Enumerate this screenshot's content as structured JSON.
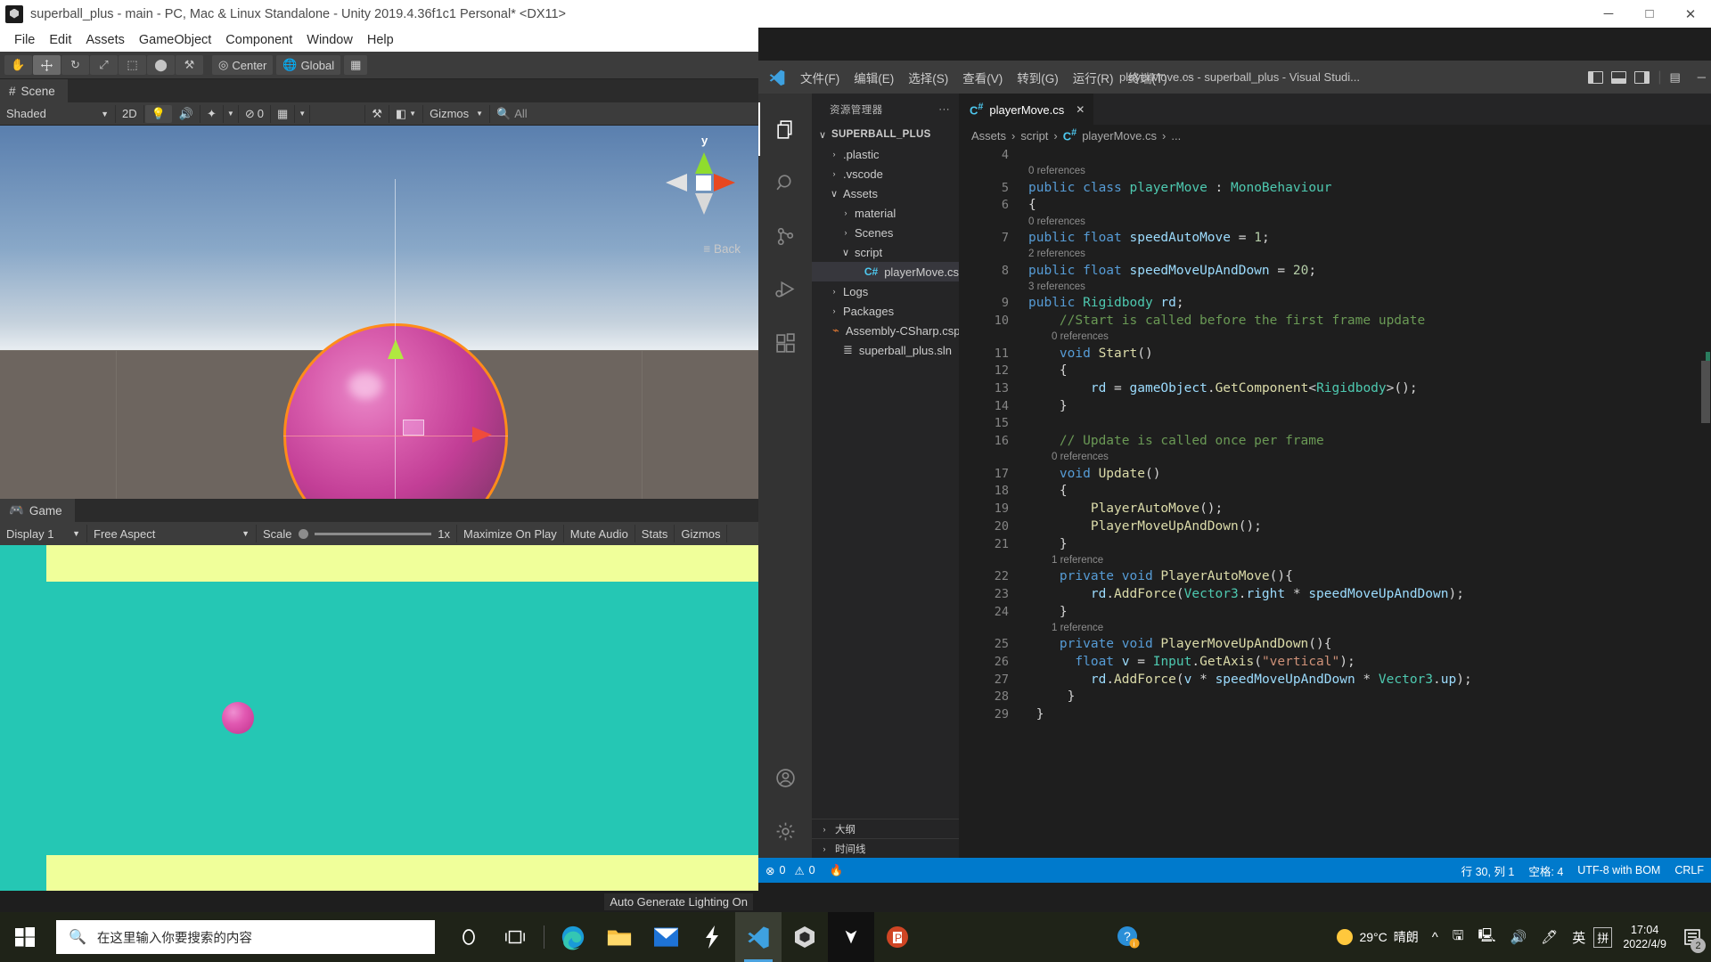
{
  "unity": {
    "title": "superball_plus - main - PC, Mac & Linux Standalone - Unity 2019.4.36f1c1 Personal* <DX11>",
    "window_buttons": {
      "minimize": "─",
      "maximize": "□",
      "close": "✕"
    },
    "menu": [
      "File",
      "Edit",
      "Assets",
      "GameObject",
      "Component",
      "Window",
      "Help"
    ],
    "toolbar": {
      "tools": [
        "hand-tool",
        "move-tool",
        "rotate-tool",
        "scale-tool",
        "rect-tool",
        "transform-tool",
        "custom-tool"
      ],
      "pivot_label": "Center",
      "space_label": "Global",
      "grid_label": "grid-snap"
    },
    "scene_tab": "Scene",
    "scene_controls": {
      "shading": "Shaded",
      "mode_2d": "2D",
      "lighting": "lighting-toggle",
      "audio": "audio-toggle",
      "fx": "effects-toggle",
      "hidden_count": "0",
      "grid": "grid-toggle",
      "tools": "scene-tools",
      "camera": "camera-toggle",
      "gizmos": "Gizmos",
      "search_placeholder": "All"
    },
    "gizmo": {
      "axis_y": "y",
      "view_label": "Back"
    },
    "game_tab": "Game",
    "game_controls": {
      "display": "Display 1",
      "aspect": "Free Aspect",
      "scale_label": "Scale",
      "scale_value": "1x",
      "maximize": "Maximize On Play",
      "mute": "Mute Audio",
      "stats": "Stats",
      "gizmos": "Gizmos"
    },
    "lighting_note": "Auto Generate Lighting On"
  },
  "vscode": {
    "menu": [
      "文件(F)",
      "编辑(E)",
      "选择(S)",
      "查看(V)",
      "转到(G)",
      "运行(R)",
      "终端(T)",
      "···"
    ],
    "window_title": "playerMove.cs - superball_plus - Visual Studi...",
    "minimize": "─",
    "activity_icons": [
      "explorer-icon",
      "search-icon",
      "source-control-icon",
      "run-debug-icon",
      "extensions-icon",
      "account-icon",
      "settings-gear-icon"
    ],
    "sidebar": {
      "header": "资源管理器",
      "more": "···",
      "tree": [
        {
          "label": "SUPERBALL_PLUS",
          "indent": 0,
          "chev": "∨",
          "root": true
        },
        {
          "label": ".plastic",
          "indent": 1,
          "chev": "›"
        },
        {
          "label": ".vscode",
          "indent": 1,
          "chev": "›"
        },
        {
          "label": "Assets",
          "indent": 1,
          "chev": "∨"
        },
        {
          "label": "material",
          "indent": 2,
          "chev": "›"
        },
        {
          "label": "Scenes",
          "indent": 2,
          "chev": "›"
        },
        {
          "label": "script",
          "indent": 2,
          "chev": "∨"
        },
        {
          "label": "playerMove.cs",
          "indent": 3,
          "chev": "",
          "icon": "csharp-file-icon",
          "selected": true
        },
        {
          "label": "Logs",
          "indent": 1,
          "chev": "›"
        },
        {
          "label": "Packages",
          "indent": 1,
          "chev": "›"
        },
        {
          "label": "Assembly-CSharp.csp...",
          "indent": 1,
          "chev": "",
          "icon": "config-file-icon"
        },
        {
          "label": "superball_plus.sln",
          "indent": 1,
          "chev": "",
          "icon": "solution-file-icon"
        }
      ],
      "panels": [
        {
          "label": "大纲",
          "chev": "›"
        },
        {
          "label": "时间线",
          "chev": "›"
        }
      ]
    },
    "tab": {
      "label": "playerMove.cs",
      "close": "✕"
    },
    "breadcrumb": [
      "Assets",
      "script",
      "playerMove.cs",
      "..."
    ],
    "code_lines": [
      {
        "no": "4",
        "segs": []
      },
      {
        "ref": "0 references",
        "indent": 0
      },
      {
        "no": "5",
        "segs": [
          [
            "kw",
            "public "
          ],
          [
            "kw",
            "class "
          ],
          [
            "ty",
            "playerMove"
          ],
          [
            "pn",
            " : "
          ],
          [
            "ty",
            "MonoBehaviour"
          ]
        ]
      },
      {
        "no": "6",
        "segs": [
          [
            "pn",
            "{"
          ]
        ]
      },
      {
        "ref": "0 references",
        "indent": 0
      },
      {
        "no": "7",
        "segs": [
          [
            "kw",
            "public "
          ],
          [
            "kw",
            "float "
          ],
          [
            "va",
            "speedAutoMove"
          ],
          [
            "pn",
            " = "
          ],
          [
            "nu",
            "1"
          ],
          [
            "pn",
            ";"
          ]
        ]
      },
      {
        "ref": "2 references",
        "indent": 0
      },
      {
        "no": "8",
        "segs": [
          [
            "kw",
            "public "
          ],
          [
            "kw",
            "float "
          ],
          [
            "va",
            "speedMoveUpAndDown"
          ],
          [
            "pn",
            " = "
          ],
          [
            "nu",
            "20"
          ],
          [
            "pn",
            ";"
          ]
        ]
      },
      {
        "ref": "3 references",
        "indent": 0
      },
      {
        "no": "9",
        "segs": [
          [
            "kw",
            "public "
          ],
          [
            "ty",
            "Rigidbody"
          ],
          [
            "pn",
            " "
          ],
          [
            "va",
            "rd"
          ],
          [
            "pn",
            ";"
          ]
        ]
      },
      {
        "no": "10",
        "segs": [
          [
            "cm",
            "    //Start is called before the first frame update"
          ]
        ]
      },
      {
        "ref": "0 references",
        "indent": 1
      },
      {
        "no": "11",
        "segs": [
          [
            "pn",
            "    "
          ],
          [
            "kw",
            "void "
          ],
          [
            "fn",
            "Start"
          ],
          [
            "pn",
            "()"
          ]
        ]
      },
      {
        "no": "12",
        "segs": [
          [
            "pn",
            "    {"
          ]
        ]
      },
      {
        "no": "13",
        "segs": [
          [
            "pn",
            "        "
          ],
          [
            "va",
            "rd"
          ],
          [
            "pn",
            " = "
          ],
          [
            "va",
            "gameObject"
          ],
          [
            "pn",
            "."
          ],
          [
            "fn",
            "GetComponent"
          ],
          [
            "pn",
            "<"
          ],
          [
            "ty",
            "Rigidbody"
          ],
          [
            "pn",
            ">();"
          ]
        ]
      },
      {
        "no": "14",
        "segs": [
          [
            "pn",
            "    }"
          ]
        ]
      },
      {
        "no": "15",
        "segs": []
      },
      {
        "no": "16",
        "segs": [
          [
            "cm",
            "    // Update is called once per frame"
          ]
        ]
      },
      {
        "ref": "0 references",
        "indent": 1
      },
      {
        "no": "17",
        "segs": [
          [
            "pn",
            "    "
          ],
          [
            "kw",
            "void "
          ],
          [
            "fn",
            "Update"
          ],
          [
            "pn",
            "()"
          ]
        ]
      },
      {
        "no": "18",
        "segs": [
          [
            "pn",
            "    {"
          ]
        ]
      },
      {
        "no": "19",
        "segs": [
          [
            "pn",
            "        "
          ],
          [
            "fn",
            "PlayerAutoMove"
          ],
          [
            "pn",
            "();"
          ]
        ]
      },
      {
        "no": "20",
        "segs": [
          [
            "pn",
            "        "
          ],
          [
            "fn",
            "PlayerMoveUpAndDown"
          ],
          [
            "pn",
            "();"
          ]
        ]
      },
      {
        "no": "21",
        "segs": [
          [
            "pn",
            "    }"
          ]
        ]
      },
      {
        "ref": "1 reference",
        "indent": 1
      },
      {
        "no": "22",
        "segs": [
          [
            "pn",
            "    "
          ],
          [
            "kw",
            "private "
          ],
          [
            "kw",
            "void "
          ],
          [
            "fn",
            "PlayerAutoMove"
          ],
          [
            "pn",
            "(){"
          ]
        ]
      },
      {
        "no": "23",
        "segs": [
          [
            "pn",
            "        "
          ],
          [
            "va",
            "rd"
          ],
          [
            "pn",
            "."
          ],
          [
            "fn",
            "AddForce"
          ],
          [
            "pn",
            "("
          ],
          [
            "ty",
            "Vector3"
          ],
          [
            "pn",
            "."
          ],
          [
            "va",
            "right"
          ],
          [
            "pn",
            " * "
          ],
          [
            "va",
            "speedMoveUpAndDown"
          ],
          [
            "pn",
            ");"
          ]
        ]
      },
      {
        "no": "24",
        "segs": [
          [
            "pn",
            "    }"
          ]
        ]
      },
      {
        "ref": "1 reference",
        "indent": 1
      },
      {
        "no": "25",
        "segs": [
          [
            "pn",
            "    "
          ],
          [
            "kw",
            "private "
          ],
          [
            "kw",
            "void "
          ],
          [
            "fn",
            "PlayerMoveUpAndDown"
          ],
          [
            "pn",
            "(){"
          ]
        ]
      },
      {
        "no": "26",
        "segs": [
          [
            "pn",
            "      "
          ],
          [
            "kw",
            "float "
          ],
          [
            "va",
            "v"
          ],
          [
            "pn",
            " = "
          ],
          [
            "ty",
            "Input"
          ],
          [
            "pn",
            "."
          ],
          [
            "fn",
            "GetAxis"
          ],
          [
            "pn",
            "("
          ],
          [
            "st",
            "\"vertical\""
          ],
          [
            "pn",
            ");"
          ]
        ]
      },
      {
        "no": "27",
        "segs": [
          [
            "pn",
            "        "
          ],
          [
            "va",
            "rd"
          ],
          [
            "pn",
            "."
          ],
          [
            "fn",
            "AddForce"
          ],
          [
            "pn",
            "("
          ],
          [
            "va",
            "v"
          ],
          [
            "pn",
            " * "
          ],
          [
            "va",
            "speedMoveUpAndDown"
          ],
          [
            "pn",
            " * "
          ],
          [
            "ty",
            "Vector3"
          ],
          [
            "pn",
            "."
          ],
          [
            "va",
            "up"
          ],
          [
            "pn",
            ");"
          ]
        ]
      },
      {
        "no": "28",
        "segs": [
          [
            "pn",
            "     }"
          ]
        ]
      },
      {
        "no": "29",
        "segs": [
          [
            "pn",
            " }"
          ]
        ]
      }
    ],
    "status": {
      "errors": "0",
      "warnings": "0",
      "flame": "radon-icon",
      "position": "行 30, 列 1",
      "indent": "空格: 4",
      "encoding": "UTF-8 with BOM",
      "eol": "CRLF"
    }
  },
  "taskbar": {
    "start": "windows-start-icon",
    "search_placeholder": "在这里输入你要搜索的内容",
    "pinned": [
      "cortana-icon",
      "task-view-icon",
      "edge-icon",
      "file-explorer-icon",
      "mail-icon",
      "sharex-icon",
      "vscode-icon",
      "unity-hub-icon",
      "unity-editor-icon",
      "powerpoint-icon"
    ],
    "tray_help": "help-icon",
    "weather_temp": "29°C",
    "weather_desc": "晴朗",
    "tray": [
      "chevron-up-icon",
      "storage-icon",
      "network-icon",
      "volume-icon",
      "pen-icon"
    ],
    "ime": "英",
    "ime2": "ime-mode-icon",
    "time": "17:04",
    "date": "2022/4/9",
    "notif_count": "2"
  }
}
